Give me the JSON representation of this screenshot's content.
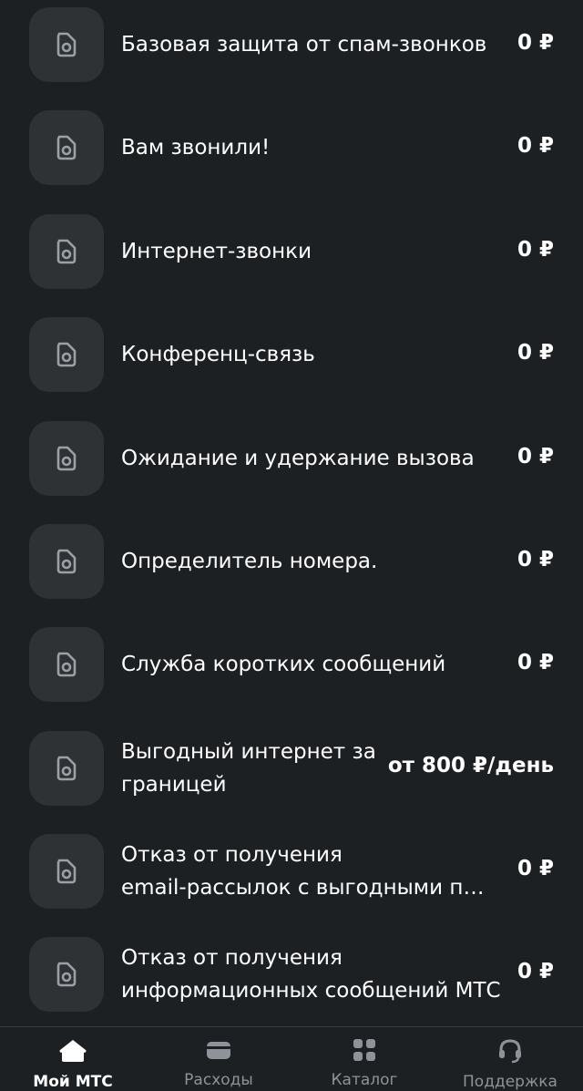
{
  "services": [
    {
      "name": "Базовая защита от спам-звонков",
      "price": "0 ₽",
      "icon": "service-doc-icon"
    },
    {
      "name": "Вам звонили!",
      "price": "0 ₽",
      "icon": "service-doc-icon"
    },
    {
      "name": "Интернет-звонки",
      "price": "0 ₽",
      "icon": "service-doc-icon"
    },
    {
      "name": "Конференц-связь",
      "price": "0 ₽",
      "icon": "service-doc-icon"
    },
    {
      "name": "Ожидание и удержание вызова",
      "price": "0 ₽",
      "icon": "service-doc-icon"
    },
    {
      "name": "Определитель номера.",
      "price": "0 ₽",
      "icon": "service-doc-icon"
    },
    {
      "name": "Служба коротких сообщений",
      "price": "0 ₽",
      "icon": "service-doc-icon"
    },
    {
      "name_line1": "Выгодный интернет за",
      "name_line2": "границей",
      "price": "от 800 ₽/день",
      "icon": "service-doc-icon"
    },
    {
      "name_line1": "Отказ от получения",
      "name_line2": "email-рассылок с выгодными пр...",
      "price": "0 ₽",
      "icon": "service-doc-icon"
    },
    {
      "name_line1": "Отказ от получения",
      "name_line2": "информационных сообщений МТС",
      "price": "0 ₽",
      "icon": "service-doc-icon"
    }
  ],
  "tabbar": {
    "tabs": [
      {
        "label": "Мой МТС",
        "icon": "home-icon",
        "active": true
      },
      {
        "label": "Расходы",
        "icon": "wallet-icon",
        "active": false
      },
      {
        "label": "Каталог",
        "icon": "grid-icon",
        "active": false
      },
      {
        "label": "Поддержка",
        "icon": "headset-icon",
        "active": false
      }
    ]
  },
  "colors": {
    "background": "#1d2023",
    "tile": "#2e3235",
    "icon_stroke": "#9aa0a6",
    "inactive_label": "#8d9399",
    "text": "#ffffff"
  }
}
